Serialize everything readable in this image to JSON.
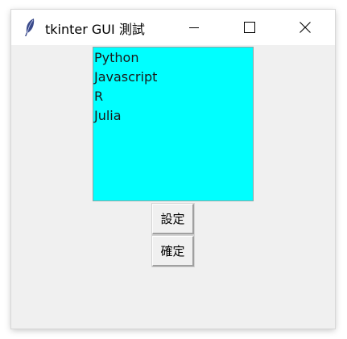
{
  "window": {
    "title": "tkinter GUI 測試",
    "icon": "feather-icon",
    "controls": [
      "minimize-icon",
      "maximize-icon",
      "close-icon"
    ]
  },
  "listbox": {
    "background": "#00ffff",
    "items": [
      "Python",
      "Javascript",
      "R",
      "Julia"
    ]
  },
  "buttons": {
    "set_label": "設定",
    "confirm_label": "確定"
  }
}
